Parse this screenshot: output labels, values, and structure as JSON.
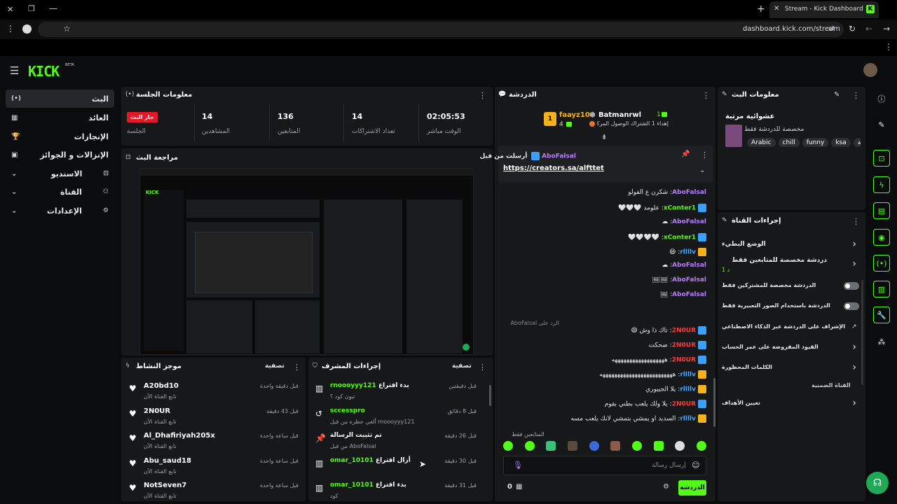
{
  "browser": {
    "tab_title": "Stream - Kick Dashboard",
    "url": "dashboard.kick.com/stream"
  },
  "brand": {
    "logo": "KICK",
    "beta": "BETA",
    "accent": "#53fc18"
  },
  "sidebar": {
    "items": [
      {
        "label": "البث",
        "icon": "broadcast-icon"
      },
      {
        "label": "العائد",
        "icon": "revenue-icon"
      },
      {
        "label": "الإنجازات",
        "icon": "trophy-icon"
      },
      {
        "label": "الإنزالات و الجوائز",
        "icon": "gift-icon"
      },
      {
        "label": "الاستديو",
        "icon": "studio-icon"
      },
      {
        "label": "القناة",
        "icon": "channel-icon"
      },
      {
        "label": "الإعدادات",
        "icon": "gear-icon"
      }
    ]
  },
  "session": {
    "title": "معلومات الجلسة",
    "live_badge": "جار البث",
    "live_label": "الجلسة",
    "stats": [
      {
        "value": "14",
        "label": "المشاهدين"
      },
      {
        "value": "136",
        "label": "المتابعين"
      },
      {
        "value": "14",
        "label": "تعداد الاشتراكات"
      },
      {
        "value": "02:05:53",
        "label": "الوقت مباشر"
      }
    ]
  },
  "preview": {
    "title": "مراجعة البث"
  },
  "chat": {
    "title": "الدردشة",
    "top_supporters": [
      {
        "rank": "1",
        "name": "faayz10",
        "count": "4"
      },
      {
        "rank": "1",
        "name": "Batmanrwl",
        "note": "إهداء 1 الشتراك الوصول المركز 3"
      }
    ],
    "pinned": {
      "header": "أرسلت من قبل",
      "by": "AboFalsal",
      "link": "https://creators.sa/alfttet"
    },
    "messages": [
      {
        "user": "AboFalsal",
        "text": "شكرن ع الفولو",
        "color": "#b57cff",
        "badge": ""
      },
      {
        "user": "xConter1",
        "text": "علومد 🤍🤍🤍",
        "color": "#53fc18",
        "badge": "mod"
      },
      {
        "user": "AboFalsal",
        "text": "☁",
        "color": "#b57cff",
        "badge": ""
      },
      {
        "user": "xConter1",
        "text": "🤍🤍🤍🤍",
        "color": "#53fc18",
        "badge": "mod"
      },
      {
        "user": "rllllv",
        "text": "😄",
        "color": "#4aa8ff",
        "badge": "vip"
      },
      {
        "user": "AboFalsal",
        "text": "☁",
        "color": "#b57cff",
        "badge": ""
      },
      {
        "user": "AboFalsal",
        "text": "🖼🖼",
        "color": "#b57cff",
        "badge": ""
      },
      {
        "user": "AboFalsal",
        "text": "🖼",
        "color": "#b57cff",
        "badge": ""
      },
      {
        "user": "2N0UR",
        "text": "تاك ذا وش 😄",
        "color": "#ff3b3b",
        "badge": "mod"
      },
      {
        "user": "2N0UR",
        "text": "ضحكت",
        "color": "#ff3b3b",
        "badge": "mod"
      },
      {
        "user": "2N0UR",
        "text": "ههههههههههههههههههه",
        "color": "#ff3b3b",
        "badge": "mod"
      },
      {
        "user": "rllllv",
        "text": "هههههههههههههههههههههههههه",
        "color": "#4aa8ff",
        "badge": "vip"
      },
      {
        "user": "rllllv",
        "text": "يلا الجيبوري",
        "color": "#4aa8ff",
        "badge": "vip"
      },
      {
        "user": "2N0UR",
        "text": "يلا ولك يلعب بطني بقوم",
        "color": "#ff3b3b",
        "badge": "mod"
      },
      {
        "user": "rllllv",
        "text": "السديد او يمشي بتمشي لانك يلعب مسه",
        "color": "#4aa8ff",
        "badge": "vip"
      }
    ],
    "reply_hint": "الرد على AboFalsal",
    "emote_section": "المتابعين فقط",
    "input_placeholder": "إرسال رسالة",
    "send_label": "الدردشة",
    "points": "0"
  },
  "stream_info": {
    "title": "معلومات البث",
    "name": "عشوائية مرتبة",
    "category": "مخصصة للدردشة فقط",
    "tags": [
      "Arabic",
      "chill",
      "funny",
      "ksa",
      "عربية"
    ]
  },
  "channel_actions": {
    "title": "إجراءات القناة",
    "items": [
      {
        "label": "الوضع البطيء",
        "control": "chevron"
      },
      {
        "label": "دردشة مخصصة للمتابعين فقط",
        "sub": "1 د",
        "control": "chevron"
      },
      {
        "label": "الدردشة مخصصة للمشتركين فقط",
        "control": "toggle"
      },
      {
        "label": "الدردشة باستخدام الصور التعبيرية فقط",
        "control": "toggle"
      },
      {
        "label": "الإشراف على الدردشة عبر الذكاء الاصطناعي",
        "control": "external"
      },
      {
        "label": "القيود المفروضة على عمر الحساب",
        "control": "chevron"
      },
      {
        "label": "الكلمات المحظورة",
        "control": "chevron"
      }
    ],
    "section": "القناة الضمنية",
    "goals": "تعيين الأهداف"
  },
  "activity": {
    "title": "موجز النشاط",
    "filter": "تصفية",
    "items": [
      {
        "user": "A20bd10",
        "sub": "تابع القناة الآن",
        "time": "قبل دقيقة واحدة"
      },
      {
        "user": "2N0UR",
        "sub": "تابع القناة الآن",
        "time": "قبل 43 دقيقة"
      },
      {
        "user": "Al_Dhafiriyah205x",
        "sub": "تابع القناة الآن",
        "time": "قبل ساعة واحدة"
      },
      {
        "user": "Abu_saud18",
        "sub": "تابع القناة الآن",
        "time": "قبل ساعة واحدة"
      },
      {
        "user": "NotSeven7",
        "sub": "تابع القناة الآن",
        "time": "قبل ساعة واحدة"
      }
    ]
  },
  "mod_actions": {
    "title": "إجراءات المشرف",
    "filter": "تصفية",
    "items": [
      {
        "action": "بدء اقتراع",
        "user": "rnoooyyy121",
        "sub": "تبون كود ؟",
        "time": "قبل دقيقتين",
        "icon": "poll-icon"
      },
      {
        "action": "",
        "user": "sccesspro",
        "sub": "ألغي حظره من قبل rnoooyyy121",
        "time": "قبل 8 دقائق",
        "icon": "undo-icon"
      },
      {
        "action": "تم تثبيت الرسالة",
        "user": "",
        "sub": "من قبل AboFalsal",
        "time": "قبل 26 دقيقة",
        "icon": "pin-icon"
      },
      {
        "action": "أزال اقتراع",
        "user": "omar_10101",
        "sub": "",
        "time": "قبل 30 دقيقة",
        "icon": "poll-icon"
      },
      {
        "action": "بدء اقتراع",
        "user": "omar_10101",
        "sub": "كود",
        "time": "قبل 31 دقيقة",
        "icon": "poll-icon"
      }
    ]
  }
}
